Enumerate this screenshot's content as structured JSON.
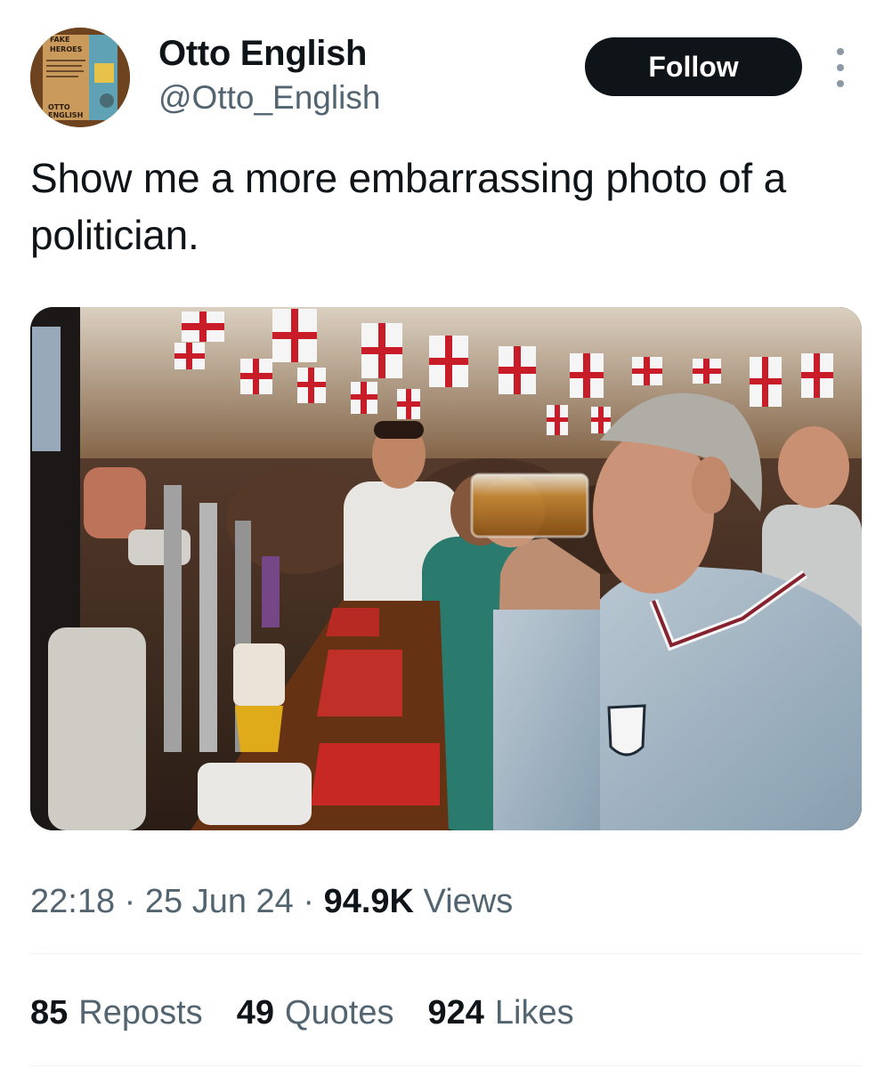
{
  "author": {
    "name": "Otto English",
    "handle": "@Otto_English",
    "avatar": "book-cover-avatar",
    "avatar_lettering": [
      "FAKE",
      "HEROES",
      "OTTO",
      "ENGLISH"
    ]
  },
  "actions": {
    "follow_label": "Follow",
    "more_icon": "more-vertical-icon"
  },
  "tweet": {
    "text": "Show me a more embarrassing photo of a politician.",
    "media_icon": "photo"
  },
  "meta": {
    "time": "22:18",
    "separator": "·",
    "date": "25 Jun 24",
    "views_count": "94.9K",
    "views_label": "Views"
  },
  "stats": {
    "reposts_count": "85",
    "reposts_label": "Reposts",
    "quotes_count": "49",
    "quotes_label": "Quotes",
    "likes_count": "924",
    "likes_label": "Likes"
  },
  "colors": {
    "text_primary": "#0f1419",
    "text_secondary": "#536471",
    "follow_bg": "#0f1419",
    "divider": "#eff3f4",
    "flag_red": "#d11f2a"
  }
}
